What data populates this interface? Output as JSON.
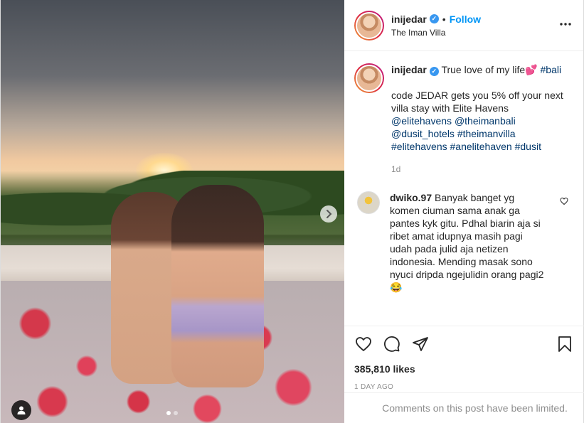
{
  "post": {
    "username": "inijedar",
    "follow_label": "Follow",
    "location": "The Iman Villa",
    "more_icon": "more-horizontal-icon"
  },
  "caption": {
    "username": "inijedar",
    "text_1": "True love of my life💕",
    "tag_1": "#bali",
    "text_2": "code JEDAR gets you 5% off your next villa stay with Elite Havens",
    "mention_1": "@elitehavens",
    "mention_2": "@theimanbali",
    "mention_3": "@dusit_hotels",
    "tag_2": "#theimanvilla",
    "tag_3": "#elitehavens",
    "tag_4": "#anelitehaven",
    "tag_5": "#dusit",
    "time_ago": "1d"
  },
  "comments": [
    {
      "username": "dwiko.97",
      "text": "Banyak banget yg komen ciuman sama anak ga pantes kyk gitu. Pdhal biarin aja si ribet amat idupnya masih pagi udah pada julid aja netizen indonesia. Mending masak sono nyuci dripda ngejulidin orang pagi2 😂"
    }
  ],
  "actions": {
    "likes": "385,810 likes",
    "posted": "1 DAY AGO",
    "limited": "Comments on this post have been limited."
  },
  "carousel": {
    "total": 2,
    "active_index": 0
  }
}
